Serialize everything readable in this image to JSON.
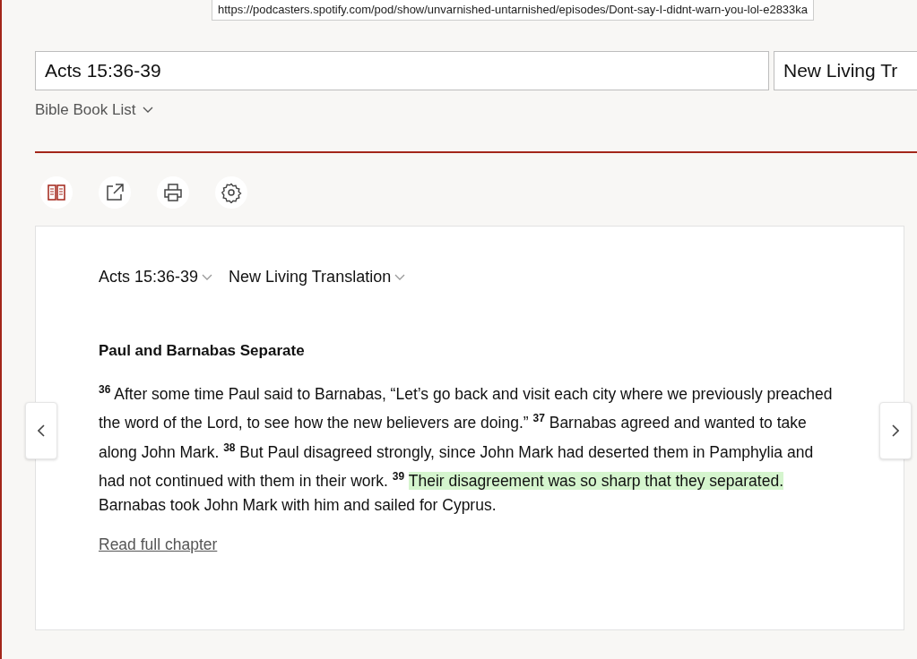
{
  "url_tooltip": "https://podcasters.spotify.com/pod/show/unvarnished-untarnished/episodes/Dont-say-I-didnt-warn-you-lol-e2833ka",
  "search": {
    "value": "Acts 15:36-39"
  },
  "version_field": {
    "value": "New Living Tr"
  },
  "book_list": {
    "label": "Bible Book List"
  },
  "toolbar": [
    {
      "kind": "parallel",
      "selected": true
    },
    {
      "kind": "share",
      "selected": false
    },
    {
      "kind": "print",
      "selected": false
    },
    {
      "kind": "settings",
      "selected": false
    }
  ],
  "passage": {
    "reference": "Acts 15:36-39",
    "translation": "New Living Translation",
    "heading": "Paul and Barnabas Separate",
    "segments": [
      {
        "verse": "36",
        "text": "After some time Paul said to Barnabas, “Let’s go back and visit each city where we previously preached the word of the Lord, to see how the new believers are doing.”",
        "highlighted": false
      },
      {
        "verse": "37",
        "text": "Barnabas agreed and wanted to take along John Mark.",
        "highlighted": false
      },
      {
        "verse": "38",
        "text": "But Paul disagreed strongly, since John Mark had deserted them in Pamphylia and had not continued with them in their work.",
        "highlighted": false
      },
      {
        "verse": "39",
        "text": "Their disagreement was so sharp that they separated.",
        "highlighted": true
      },
      {
        "text": "Barnabas took John Mark with him and sailed for Cyprus.",
        "highlighted": false
      }
    ],
    "link": "Read full chapter"
  }
}
